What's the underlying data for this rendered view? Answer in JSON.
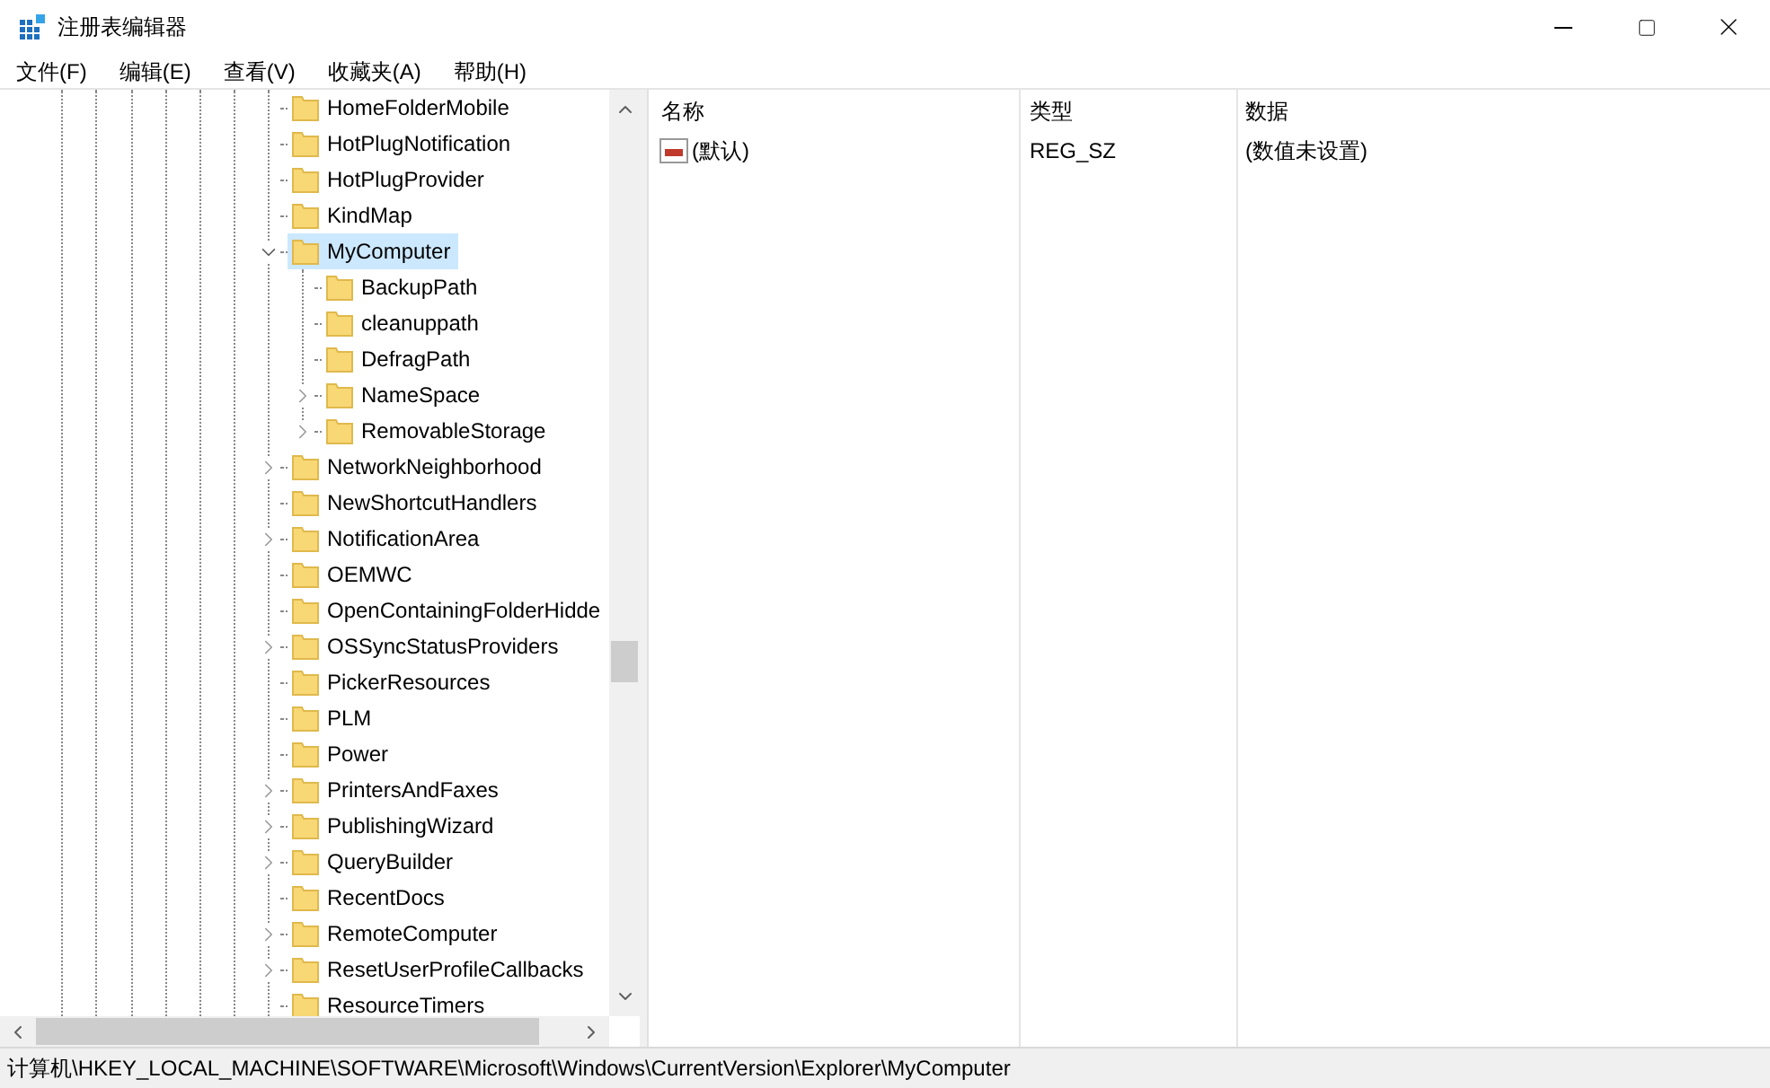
{
  "window": {
    "title": "注册表编辑器"
  },
  "menu": [
    "文件(F)",
    "编辑(E)",
    "查看(V)",
    "收藏夹(A)",
    "帮助(H)"
  ],
  "tree": [
    {
      "label": "HomeFolderMobile",
      "kind": "leaf",
      "selected": false
    },
    {
      "label": "HotPlugNotification",
      "kind": "leaf",
      "selected": false
    },
    {
      "label": "HotPlugProvider",
      "kind": "leaf",
      "selected": false
    },
    {
      "label": "KindMap",
      "kind": "leaf",
      "selected": false
    },
    {
      "label": "MyComputer",
      "kind": "branch",
      "expanded": true,
      "selected": true,
      "children": [
        {
          "label": "BackupPath",
          "kind": "leaf",
          "selected": false
        },
        {
          "label": "cleanuppath",
          "kind": "leaf",
          "selected": false
        },
        {
          "label": "DefragPath",
          "kind": "leaf",
          "selected": false
        },
        {
          "label": "NameSpace",
          "kind": "branch",
          "expanded": false,
          "selected": false
        },
        {
          "label": "RemovableStorage",
          "kind": "branch",
          "expanded": false,
          "selected": false
        }
      ]
    },
    {
      "label": "NetworkNeighborhood",
      "kind": "branch",
      "expanded": false,
      "selected": false
    },
    {
      "label": "NewShortcutHandlers",
      "kind": "leaf",
      "selected": false
    },
    {
      "label": "NotificationArea",
      "kind": "branch",
      "expanded": false,
      "selected": false
    },
    {
      "label": "OEMWC",
      "kind": "leaf",
      "selected": false
    },
    {
      "label": "OpenContainingFolderHidde",
      "kind": "leaf",
      "selected": false
    },
    {
      "label": "OSSyncStatusProviders",
      "kind": "branch",
      "expanded": false,
      "selected": false
    },
    {
      "label": "PickerResources",
      "kind": "leaf",
      "selected": false
    },
    {
      "label": "PLM",
      "kind": "leaf",
      "selected": false
    },
    {
      "label": "Power",
      "kind": "leaf",
      "selected": false
    },
    {
      "label": "PrintersAndFaxes",
      "kind": "branch",
      "expanded": false,
      "selected": false
    },
    {
      "label": "PublishingWizard",
      "kind": "branch",
      "expanded": false,
      "selected": false
    },
    {
      "label": "QueryBuilder",
      "kind": "branch",
      "expanded": false,
      "selected": false
    },
    {
      "label": "RecentDocs",
      "kind": "leaf",
      "selected": false
    },
    {
      "label": "RemoteComputer",
      "kind": "branch",
      "expanded": false,
      "selected": false
    },
    {
      "label": "ResetUserProfileCallbacks",
      "kind": "branch",
      "expanded": false,
      "selected": false
    },
    {
      "label": "ResourceTimers",
      "kind": "leaf",
      "selected": false
    }
  ],
  "values": {
    "columns": [
      "名称",
      "类型",
      "数据"
    ],
    "rows": [
      {
        "name": "(默认)",
        "type": "REG_SZ",
        "data": "(数值未设置)",
        "selected": false
      }
    ]
  },
  "status_bar": "计算机\\HKEY_LOCAL_MACHINE\\SOFTWARE\\Microsoft\\Windows\\CurrentVersion\\Explorer\\MyComputer"
}
